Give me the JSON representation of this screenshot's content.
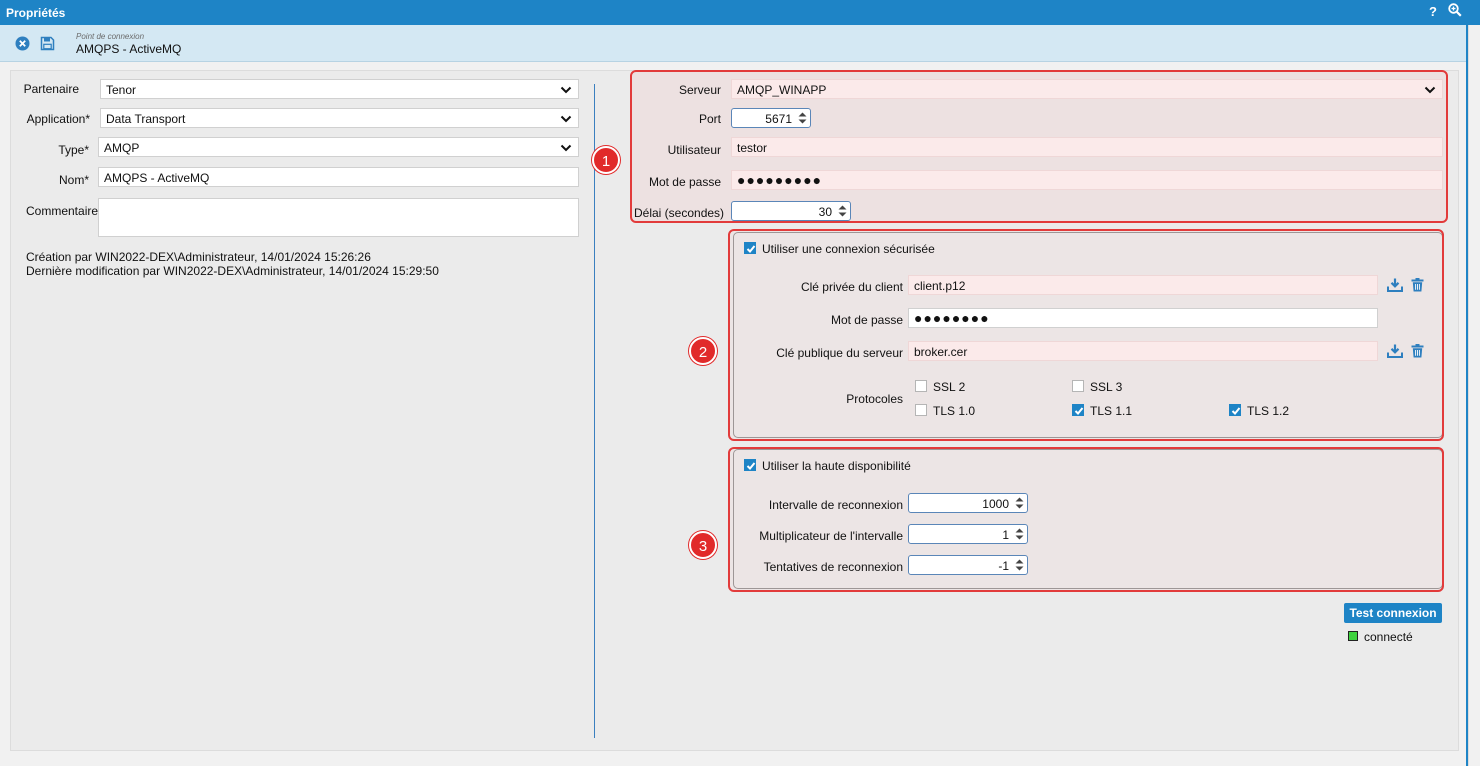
{
  "window": {
    "title": "Propriétés",
    "help_label": "?",
    "zoom_icon": "zoom-in-icon"
  },
  "header": {
    "subtitle": "Point de connexion",
    "title": "AMQPS - ActiveMQ",
    "close_icon": "close-circle-icon",
    "save_icon": "floppy-save-icon"
  },
  "left": {
    "partenaire_label": "Partenaire",
    "partenaire_value": "Tenor",
    "application_label": "Application*",
    "application_value": "Data Transport",
    "type_label": "Type*",
    "type_value": "AMQP",
    "nom_label": "Nom*",
    "nom_value": "AMQPS - ActiveMQ",
    "commentaire_label": "Commentaire",
    "commentaire_value": "",
    "creation": "Création par WIN2022-DEX\\Administrateur, 14/01/2024 15:26:26",
    "modification": "Dernière modification par WIN2022-DEX\\Administrateur, 14/01/2024 15:29:50"
  },
  "server": {
    "serveur_label": "Serveur",
    "serveur_value": "AMQP_WINAPP",
    "port_label": "Port",
    "port_value": "5671",
    "utilisateur_label": "Utilisateur",
    "utilisateur_value": "testor",
    "password_label": "Mot de passe",
    "password_value": "●●●●●●●●●",
    "delai_label": "Délai (secondes)",
    "delai_value": "30"
  },
  "secure": {
    "checkbox_label": "Utiliser une connexion sécurisée",
    "checked": true,
    "private_key_label": "Clé privée du client",
    "private_key_value": "client.p12",
    "password_label": "Mot de passe",
    "password_value": "●●●●●●●●",
    "public_key_label": "Clé publique du serveur",
    "public_key_value": "broker.cer",
    "protocols_label": "Protocoles",
    "protocols": [
      {
        "label": "SSL 2",
        "checked": false
      },
      {
        "label": "SSL 3",
        "checked": false
      },
      {
        "label": "TLS 1.0",
        "checked": false
      },
      {
        "label": "TLS 1.1",
        "checked": true
      },
      {
        "label": "TLS 1.2",
        "checked": true
      }
    ]
  },
  "ha": {
    "checkbox_label": "Utiliser la haute disponibilité",
    "checked": true,
    "interval_label": "Intervalle de reconnexion",
    "interval_value": "1000",
    "multiplier_label": "Multiplicateur de l'intervalle",
    "multiplier_value": "1",
    "attempts_label": "Tentatives de reconnexion",
    "attempts_value": "-1"
  },
  "callouts": [
    "1",
    "2",
    "3"
  ],
  "actions": {
    "test_label": "Test connexion",
    "status_label": "connecté",
    "status_color": "#3fd33f"
  },
  "colors": {
    "accent": "#1e84c6",
    "highlight": "#e23b3b"
  }
}
